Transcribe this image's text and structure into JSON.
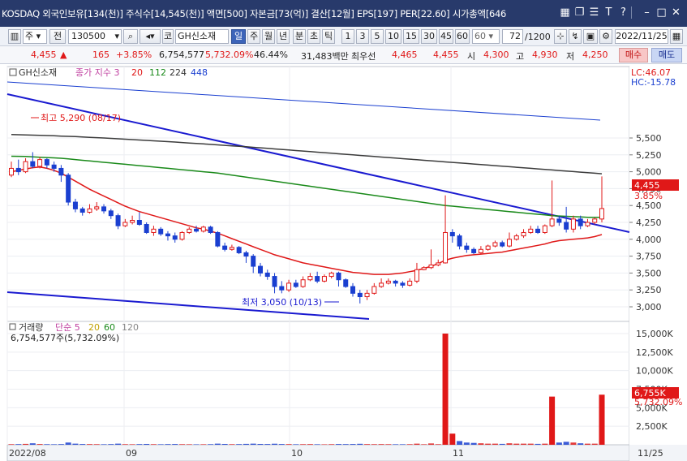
{
  "title_bar": {
    "text": "KOSDAQ 외국인보유[134(천)] 주식수[14,545(천)] 액면[500] 자본금[73(억)] 결산[12월] EPS[197] PER[22.60] 시가총액[646"
  },
  "toolbar": {
    "type": "주",
    "period_label": "전",
    "code": "130500",
    "market": "코",
    "name": "GH신소재",
    "periods": [
      "일",
      "주",
      "월",
      "년",
      "분",
      "초",
      "틱"
    ],
    "selected_period": "일",
    "nums": [
      "1",
      "3",
      "5",
      "10",
      "15",
      "30",
      "45",
      "60"
    ],
    "count_value": "60",
    "range": "72",
    "range_total": "/1200",
    "date": "2022/11/25"
  },
  "quote": {
    "price": "4,455",
    "arrow": "▲",
    "change": "165",
    "pct": "+3.85%",
    "volume": "6,754,577",
    "vol_ratio": "5,732.09%",
    "rate": "46.44%",
    "amount": "31,483백만",
    "pref_label": "최우선",
    "pref1": "4,465",
    "pref2": "4,455",
    "open_label": "시",
    "open": "4,300",
    "high_label": "고",
    "high": "4,930",
    "low_label": "저",
    "low": "4,250",
    "buy": "매수",
    "sell": "매도"
  },
  "legend": {
    "name": "GH신소재",
    "ma_label": "종가 지수 3",
    "ma1": "20",
    "ma2": "112",
    "ma3": "224",
    "ma4": "448",
    "lc": "LC:46.07",
    "hc": "HC:-15.78"
  },
  "annotations": {
    "high": "최고 5,290 (08/17)",
    "low": "최저 3,050 (10/13)"
  },
  "price_badge": {
    "price": "4,455",
    "pct": "3.85%"
  },
  "vol_legend": {
    "name": "거래량",
    "ma_label": "단순 5",
    "ma1": "20",
    "ma2": "60",
    "ma3": "120",
    "value": "6,754,577주(5,732.09%)"
  },
  "vol_badge": {
    "value": "6,755K",
    "pct": "5,732.09%"
  },
  "colors": {
    "up": "#e01818",
    "down": "#1a3fd0",
    "ma20": "#e01818",
    "ma112": "#1a8a1a",
    "ma224": "#3c3c3c",
    "ma448": "#1a3fd0",
    "trend": "#1a1ad0"
  },
  "chart_data": {
    "type": "candlestick",
    "y_ticks": [
      "5,500",
      "5,250",
      "5,000",
      "4,750",
      "4,500",
      "4,250",
      "4,000",
      "3,750",
      "3,500",
      "3,250",
      "3,000"
    ],
    "vol_ticks": [
      "15,000K",
      "12,500K",
      "10,000K",
      "7,500K",
      "5,000K",
      "2,500K"
    ],
    "x_labels": [
      "2022/08",
      "09",
      "10",
      "11",
      "11/25"
    ],
    "candles": [
      [
        4950,
        5050,
        5150,
        4920,
        80
      ],
      [
        5050,
        5000,
        5180,
        4950,
        90
      ],
      [
        5000,
        5150,
        5200,
        4980,
        120
      ],
      [
        5150,
        5080,
        5290,
        5050,
        200
      ],
      [
        5080,
        5180,
        5220,
        5050,
        100
      ],
      [
        5180,
        5100,
        5200,
        5050,
        80
      ],
      [
        5100,
        5050,
        5150,
        5000,
        70
      ],
      [
        5050,
        4950,
        5100,
        4850,
        90
      ],
      [
        4950,
        4550,
        4980,
        4500,
        300
      ],
      [
        4550,
        4450,
        4600,
        4400,
        150
      ],
      [
        4450,
        4400,
        4480,
        4350,
        100
      ],
      [
        4400,
        4450,
        4520,
        4380,
        90
      ],
      [
        4450,
        4480,
        4550,
        4420,
        80
      ],
      [
        4480,
        4420,
        4520,
        4380,
        70
      ],
      [
        4420,
        4350,
        4450,
        4300,
        90
      ],
      [
        4350,
        4200,
        4380,
        4150,
        150
      ],
      [
        4200,
        4250,
        4300,
        4180,
        80
      ],
      [
        4250,
        4280,
        4350,
        4220,
        70
      ],
      [
        4280,
        4220,
        4400,
        4200,
        90
      ],
      [
        4220,
        4100,
        4250,
        4080,
        110
      ],
      [
        4100,
        4150,
        4200,
        4050,
        80
      ],
      [
        4150,
        4080,
        4180,
        4050,
        70
      ],
      [
        4080,
        4050,
        4120,
        3980,
        90
      ],
      [
        4050,
        4000,
        4100,
        3950,
        100
      ],
      [
        4000,
        4100,
        4120,
        3980,
        80
      ],
      [
        4100,
        4150,
        4180,
        4080,
        70
      ],
      [
        4150,
        4120,
        4200,
        4100,
        60
      ],
      [
        4120,
        4180,
        4200,
        4100,
        70
      ],
      [
        4180,
        4100,
        4200,
        4080,
        80
      ],
      [
        4100,
        3900,
        4120,
        3880,
        150
      ],
      [
        3900,
        3850,
        3950,
        3820,
        110
      ],
      [
        3850,
        3880,
        3920,
        3830,
        80
      ],
      [
        3880,
        3800,
        3900,
        3780,
        90
      ],
      [
        3800,
        3750,
        3830,
        3650,
        120
      ],
      [
        3750,
        3600,
        3780,
        3500,
        150
      ],
      [
        3600,
        3500,
        3650,
        3450,
        110
      ],
      [
        3500,
        3450,
        3550,
        3400,
        100
      ],
      [
        3450,
        3300,
        3500,
        3200,
        140
      ],
      [
        3300,
        3250,
        3380,
        3200,
        100
      ],
      [
        3250,
        3350,
        3400,
        3220,
        90
      ],
      [
        3350,
        3300,
        3400,
        3280,
        70
      ],
      [
        3300,
        3400,
        3450,
        3280,
        80
      ],
      [
        3400,
        3450,
        3500,
        3380,
        90
      ],
      [
        3450,
        3380,
        3520,
        3350,
        70
      ],
      [
        3380,
        3450,
        3480,
        3360,
        60
      ],
      [
        3450,
        3500,
        3520,
        3420,
        80
      ],
      [
        3500,
        3400,
        3520,
        3300,
        100
      ],
      [
        3400,
        3300,
        3420,
        3280,
        90
      ],
      [
        3300,
        3200,
        3350,
        3150,
        100
      ],
      [
        3200,
        3150,
        3250,
        3050,
        130
      ],
      [
        3150,
        3200,
        3250,
        3100,
        90
      ],
      [
        3200,
        3300,
        3350,
        3180,
        80
      ],
      [
        3300,
        3350,
        3420,
        3280,
        90
      ],
      [
        3350,
        3380,
        3420,
        3330,
        80
      ],
      [
        3380,
        3350,
        3400,
        3300,
        70
      ],
      [
        3350,
        3320,
        3380,
        3280,
        70
      ],
      [
        3320,
        3380,
        3420,
        3300,
        80
      ],
      [
        3380,
        3550,
        3650,
        3350,
        150
      ],
      [
        3550,
        3580,
        3600,
        3540,
        70
      ],
      [
        3580,
        3620,
        3850,
        3560,
        180
      ],
      [
        3620,
        3650,
        3700,
        3600,
        80
      ],
      [
        3650,
        4100,
        4650,
        3640,
        15000
      ],
      [
        4100,
        4050,
        4150,
        3950,
        1500
      ],
      [
        4050,
        3900,
        4080,
        3850,
        500
      ],
      [
        3900,
        3850,
        3950,
        3800,
        300
      ],
      [
        3850,
        3800,
        3880,
        3780,
        250
      ],
      [
        3800,
        3850,
        3900,
        3780,
        200
      ],
      [
        3850,
        3900,
        3920,
        3830,
        150
      ],
      [
        3900,
        3950,
        3980,
        3880,
        150
      ],
      [
        3950,
        3900,
        3980,
        3880,
        120
      ],
      [
        3900,
        4000,
        4100,
        3880,
        200
      ],
      [
        4000,
        4050,
        4080,
        3980,
        150
      ],
      [
        4050,
        4100,
        4150,
        4020,
        150
      ],
      [
        4100,
        4150,
        4200,
        4080,
        150
      ],
      [
        4150,
        4100,
        4200,
        4080,
        120
      ],
      [
        4100,
        4200,
        4220,
        4080,
        150
      ],
      [
        4200,
        4300,
        4870,
        4180,
        6500
      ],
      [
        4300,
        4250,
        4350,
        4200,
        300
      ],
      [
        4250,
        4150,
        4480,
        4100,
        400
      ],
      [
        4150,
        4300,
        4350,
        4100,
        300
      ],
      [
        4300,
        4200,
        4350,
        4150,
        200
      ],
      [
        4200,
        4250,
        4300,
        4180,
        150
      ],
      [
        4250,
        4300,
        4320,
        4220,
        150
      ],
      [
        4300,
        4455,
        4930,
        4250,
        6755
      ]
    ],
    "ma20": [
      5000,
      5020,
      5040,
      5060,
      5070,
      5050,
      5020,
      4980,
      4920,
      4860,
      4800,
      4740,
      4690,
      4640,
      4590,
      4540,
      4490,
      4450,
      4410,
      4380,
      4350,
      4320,
      4290,
      4260,
      4230,
      4200,
      4170,
      4150,
      4120,
      4090,
      4050,
      4010,
      3970,
      3930,
      3890,
      3850,
      3810,
      3770,
      3740,
      3710,
      3680,
      3650,
      3630,
      3610,
      3590,
      3570,
      3550,
      3530,
      3510,
      3500,
      3490,
      3480,
      3480,
      3480,
      3490,
      3500,
      3520,
      3540,
      3570,
      3600,
      3640,
      3690,
      3720,
      3740,
      3760,
      3770,
      3780,
      3790,
      3800,
      3810,
      3830,
      3850,
      3870,
      3890,
      3910,
      3930,
      3960,
      3980,
      3990,
      4000,
      4010,
      4020,
      4040,
      4070
    ],
    "ma112": [
      5230,
      5228,
      5226,
      5220,
      5215,
      5210,
      5205,
      5200,
      5190,
      5180,
      5170,
      5160,
      5150,
      5140,
      5130,
      5120,
      5110,
      5100,
      5090,
      5080,
      5070,
      5060,
      5050,
      5040,
      5030,
      5020,
      5010,
      5000,
      4990,
      4980,
      4965,
      4950,
      4935,
      4920,
      4905,
      4890,
      4875,
      4860,
      4845,
      4830,
      4815,
      4800,
      4785,
      4770,
      4755,
      4740,
      4725,
      4710,
      4695,
      4680,
      4665,
      4650,
      4635,
      4620,
      4605,
      4590,
      4575,
      4560,
      4545,
      4530,
      4515,
      4500,
      4490,
      4480,
      4470,
      4460,
      4450,
      4440,
      4430,
      4420,
      4410,
      4400,
      4390,
      4380,
      4370,
      4360,
      4350,
      4345,
      4340,
      4335,
      4330,
      4325,
      4325,
      4325
    ],
    "ma224": [
      5550,
      5548,
      5545,
      5542,
      5540,
      5536,
      5532,
      5528,
      5524,
      5520,
      5515,
      5510,
      5505,
      5500,
      5494,
      5488,
      5482,
      5476,
      5470,
      5464,
      5458,
      5452,
      5446,
      5440,
      5433,
      5426,
      5419,
      5412,
      5405,
      5398,
      5391,
      5384,
      5377,
      5370,
      5362,
      5354,
      5346,
      5338,
      5330,
      5322,
      5314,
      5306,
      5298,
      5290,
      5282,
      5274,
      5266,
      5258,
      5250,
      5242,
      5234,
      5226,
      5218,
      5210,
      5202,
      5194,
      5186,
      5178,
      5170,
      5162,
      5154,
      5146,
      5138,
      5130,
      5122,
      5114,
      5106,
      5098,
      5090,
      5082,
      5074,
      5066,
      5058,
      5050,
      5042,
      5034,
      5026,
      5018,
      5010,
      5002,
      4994,
      4986,
      4978,
      4970
    ]
  }
}
